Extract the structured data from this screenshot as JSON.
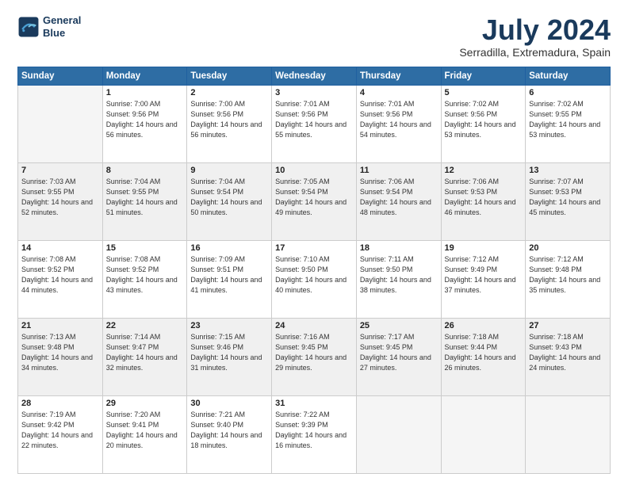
{
  "header": {
    "logo_line1": "General",
    "logo_line2": "Blue",
    "title": "July 2024",
    "subtitle": "Serradilla, Extremadura, Spain"
  },
  "weekdays": [
    "Sunday",
    "Monday",
    "Tuesday",
    "Wednesday",
    "Thursday",
    "Friday",
    "Saturday"
  ],
  "weeks": [
    [
      {
        "day": "",
        "empty": true
      },
      {
        "day": "1",
        "sunrise": "7:00 AM",
        "sunset": "9:56 PM",
        "daylight": "14 hours and 56 minutes."
      },
      {
        "day": "2",
        "sunrise": "7:00 AM",
        "sunset": "9:56 PM",
        "daylight": "14 hours and 56 minutes."
      },
      {
        "day": "3",
        "sunrise": "7:01 AM",
        "sunset": "9:56 PM",
        "daylight": "14 hours and 55 minutes."
      },
      {
        "day": "4",
        "sunrise": "7:01 AM",
        "sunset": "9:56 PM",
        "daylight": "14 hours and 54 minutes."
      },
      {
        "day": "5",
        "sunrise": "7:02 AM",
        "sunset": "9:56 PM",
        "daylight": "14 hours and 53 minutes."
      },
      {
        "day": "6",
        "sunrise": "7:02 AM",
        "sunset": "9:55 PM",
        "daylight": "14 hours and 53 minutes."
      }
    ],
    [
      {
        "day": "7",
        "sunrise": "7:03 AM",
        "sunset": "9:55 PM",
        "daylight": "14 hours and 52 minutes."
      },
      {
        "day": "8",
        "sunrise": "7:04 AM",
        "sunset": "9:55 PM",
        "daylight": "14 hours and 51 minutes."
      },
      {
        "day": "9",
        "sunrise": "7:04 AM",
        "sunset": "9:54 PM",
        "daylight": "14 hours and 50 minutes."
      },
      {
        "day": "10",
        "sunrise": "7:05 AM",
        "sunset": "9:54 PM",
        "daylight": "14 hours and 49 minutes."
      },
      {
        "day": "11",
        "sunrise": "7:06 AM",
        "sunset": "9:54 PM",
        "daylight": "14 hours and 48 minutes."
      },
      {
        "day": "12",
        "sunrise": "7:06 AM",
        "sunset": "9:53 PM",
        "daylight": "14 hours and 46 minutes."
      },
      {
        "day": "13",
        "sunrise": "7:07 AM",
        "sunset": "9:53 PM",
        "daylight": "14 hours and 45 minutes."
      }
    ],
    [
      {
        "day": "14",
        "sunrise": "7:08 AM",
        "sunset": "9:52 PM",
        "daylight": "14 hours and 44 minutes."
      },
      {
        "day": "15",
        "sunrise": "7:08 AM",
        "sunset": "9:52 PM",
        "daylight": "14 hours and 43 minutes."
      },
      {
        "day": "16",
        "sunrise": "7:09 AM",
        "sunset": "9:51 PM",
        "daylight": "14 hours and 41 minutes."
      },
      {
        "day": "17",
        "sunrise": "7:10 AM",
        "sunset": "9:50 PM",
        "daylight": "14 hours and 40 minutes."
      },
      {
        "day": "18",
        "sunrise": "7:11 AM",
        "sunset": "9:50 PM",
        "daylight": "14 hours and 38 minutes."
      },
      {
        "day": "19",
        "sunrise": "7:12 AM",
        "sunset": "9:49 PM",
        "daylight": "14 hours and 37 minutes."
      },
      {
        "day": "20",
        "sunrise": "7:12 AM",
        "sunset": "9:48 PM",
        "daylight": "14 hours and 35 minutes."
      }
    ],
    [
      {
        "day": "21",
        "sunrise": "7:13 AM",
        "sunset": "9:48 PM",
        "daylight": "14 hours and 34 minutes."
      },
      {
        "day": "22",
        "sunrise": "7:14 AM",
        "sunset": "9:47 PM",
        "daylight": "14 hours and 32 minutes."
      },
      {
        "day": "23",
        "sunrise": "7:15 AM",
        "sunset": "9:46 PM",
        "daylight": "14 hours and 31 minutes."
      },
      {
        "day": "24",
        "sunrise": "7:16 AM",
        "sunset": "9:45 PM",
        "daylight": "14 hours and 29 minutes."
      },
      {
        "day": "25",
        "sunrise": "7:17 AM",
        "sunset": "9:45 PM",
        "daylight": "14 hours and 27 minutes."
      },
      {
        "day": "26",
        "sunrise": "7:18 AM",
        "sunset": "9:44 PM",
        "daylight": "14 hours and 26 minutes."
      },
      {
        "day": "27",
        "sunrise": "7:18 AM",
        "sunset": "9:43 PM",
        "daylight": "14 hours and 24 minutes."
      }
    ],
    [
      {
        "day": "28",
        "sunrise": "7:19 AM",
        "sunset": "9:42 PM",
        "daylight": "14 hours and 22 minutes."
      },
      {
        "day": "29",
        "sunrise": "7:20 AM",
        "sunset": "9:41 PM",
        "daylight": "14 hours and 20 minutes."
      },
      {
        "day": "30",
        "sunrise": "7:21 AM",
        "sunset": "9:40 PM",
        "daylight": "14 hours and 18 minutes."
      },
      {
        "day": "31",
        "sunrise": "7:22 AM",
        "sunset": "9:39 PM",
        "daylight": "14 hours and 16 minutes."
      },
      {
        "day": "",
        "empty": true
      },
      {
        "day": "",
        "empty": true
      },
      {
        "day": "",
        "empty": true
      }
    ]
  ]
}
